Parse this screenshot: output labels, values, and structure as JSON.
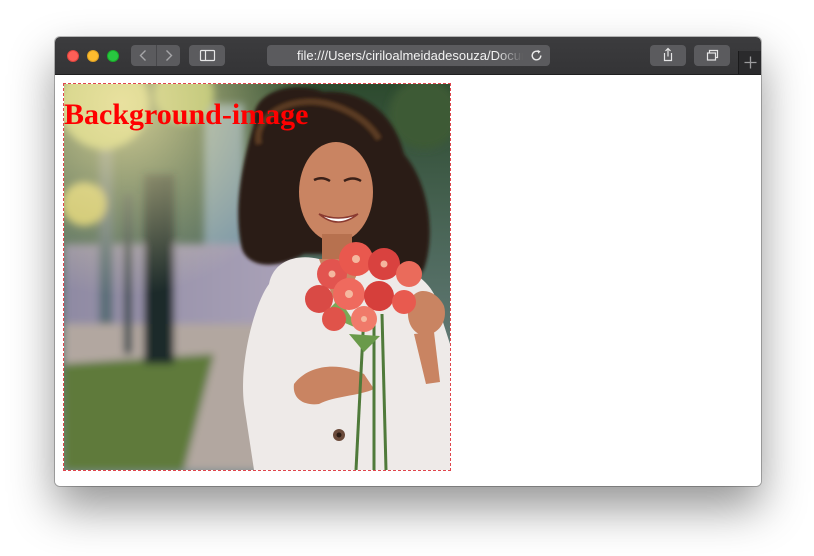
{
  "browser": {
    "address_bar": {
      "url": "file:///Users/ciriloalmeidadesouza/Documents"
    },
    "buttons": [
      "back",
      "forward",
      "sidebar",
      "reload",
      "share",
      "tabs-overview",
      "new-tab"
    ]
  },
  "page": {
    "heading": "Background-image",
    "heading_color": "#ff0000",
    "box_border_color": "#e0454d",
    "image": {
      "subject": "smiling woman with curly hair holding a bouquet of red flowers",
      "background": "sunlit street with green foliage"
    }
  }
}
